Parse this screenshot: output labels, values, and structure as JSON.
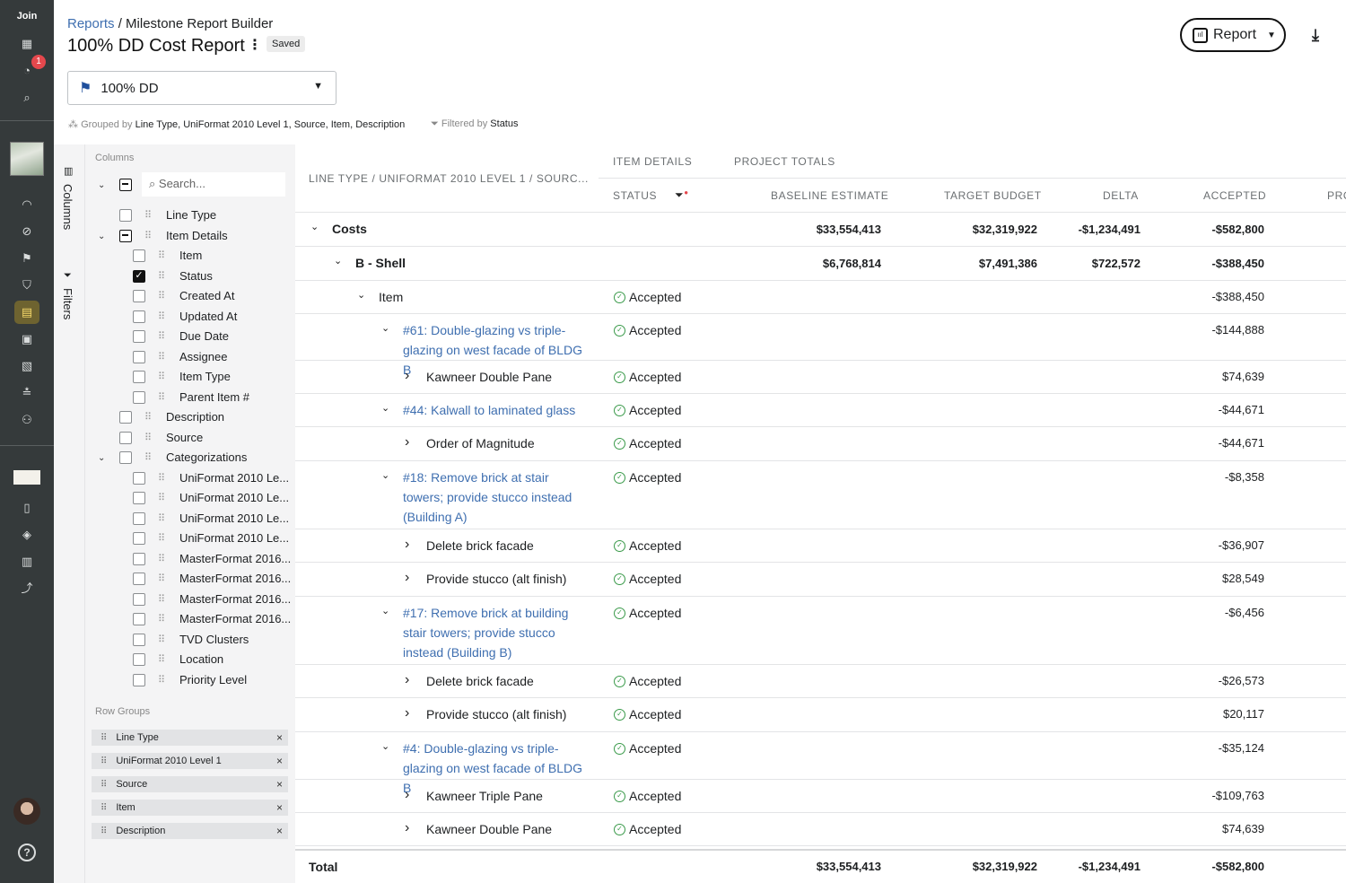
{
  "nav": {
    "brand": "Join",
    "notification_count": "1",
    "help_label": "?"
  },
  "header": {
    "breadcrumb_link": "Reports",
    "breadcrumb_sep": " / ",
    "breadcrumb_current": "Milestone Report Builder",
    "title": "100% DD Cost Report",
    "saved_badge": "Saved",
    "report_button": "Report"
  },
  "milestone_select": {
    "value": "100% DD"
  },
  "grouping": {
    "grouped_prefix": "Grouped by",
    "grouped_value": "Line Type, UniFormat 2010 Level 1, Source, Item, Description",
    "filtered_prefix": "Filtered by",
    "filtered_value": "Status"
  },
  "side_tabs": {
    "columns": "Columns",
    "filters": "Filters"
  },
  "columns_panel": {
    "header": "Columns",
    "search_placeholder": "Search...",
    "items": [
      {
        "label": "Line Type",
        "checked": false
      },
      {
        "label": "Item Details",
        "checked": "mixed"
      },
      {
        "label": "Item",
        "checked": false
      },
      {
        "label": "Status",
        "checked": true
      },
      {
        "label": "Created At",
        "checked": false
      },
      {
        "label": "Updated At",
        "checked": false
      },
      {
        "label": "Due Date",
        "checked": false
      },
      {
        "label": "Assignee",
        "checked": false
      },
      {
        "label": "Item Type",
        "checked": false
      },
      {
        "label": "Parent Item #",
        "checked": false
      },
      {
        "label": "Description",
        "checked": false
      },
      {
        "label": "Source",
        "checked": false
      },
      {
        "label": "Categorizations",
        "checked": false
      },
      {
        "label": "UniFormat 2010 Le...",
        "checked": false
      },
      {
        "label": "UniFormat 2010 Le...",
        "checked": false
      },
      {
        "label": "UniFormat 2010 Le...",
        "checked": false
      },
      {
        "label": "UniFormat 2010 Le...",
        "checked": false
      },
      {
        "label": "MasterFormat 2016...",
        "checked": false
      },
      {
        "label": "MasterFormat 2016...",
        "checked": false
      },
      {
        "label": "MasterFormat 2016...",
        "checked": false
      },
      {
        "label": "MasterFormat 2016...",
        "checked": false
      },
      {
        "label": "TVD Clusters",
        "checked": false
      },
      {
        "label": "Location",
        "checked": false
      },
      {
        "label": "Priority Level",
        "checked": false
      }
    ]
  },
  "row_groups": {
    "header": "Row Groups",
    "items": [
      "Line Type",
      "UniFormat 2010 Level 1",
      "Source",
      "Item",
      "Description"
    ]
  },
  "table": {
    "group_header": "LINE TYPE / UNIFORMAT 2010 LEVEL 1 / SOURC...",
    "band_item_details": "ITEM DETAILS",
    "band_project_totals": "PROJECT TOTALS",
    "col_status": "STATUS",
    "col_baseline": "BASELINE ESTIMATE",
    "col_target": "TARGET BUDGET",
    "col_delta": "DELTA",
    "col_accepted": "ACCEPTED",
    "col_pro": "PRO",
    "rows": [
      {
        "label": "Costs",
        "status": "",
        "baseline": "$33,554,413",
        "target": "$32,319,922",
        "delta": "-$1,234,491",
        "accepted": "-$582,800"
      },
      {
        "label": "B - Shell",
        "status": "",
        "baseline": "$6,768,814",
        "target": "$7,491,386",
        "delta": "$722,572",
        "accepted": "-$388,450"
      },
      {
        "label": "Item",
        "status": "Accepted",
        "accepted": "-$388,450"
      },
      {
        "label": "#61: Double-glazing vs triple-glazing on west facade of BLDG B",
        "status": "Accepted",
        "accepted": "-$144,888"
      },
      {
        "label": "Kawneer Double Pane",
        "status": "Accepted",
        "accepted": "$74,639"
      },
      {
        "label": "#44: Kalwall to laminated glass",
        "status": "Accepted",
        "accepted": "-$44,671"
      },
      {
        "label": "Order of Magnitude",
        "status": "Accepted",
        "accepted": "-$44,671"
      },
      {
        "label": "#18: Remove brick at stair towers; provide stucco instead (Building A)",
        "status": "Accepted",
        "accepted": "-$8,358"
      },
      {
        "label": "Delete brick facade",
        "status": "Accepted",
        "accepted": "-$36,907"
      },
      {
        "label": "Provide stucco (alt finish)",
        "status": "Accepted",
        "accepted": "$28,549"
      },
      {
        "label": "#17: Remove brick at building stair towers; provide stucco instead (Building B)",
        "status": "Accepted",
        "accepted": "-$6,456"
      },
      {
        "label": "Delete brick facade",
        "status": "Accepted",
        "accepted": "-$26,573"
      },
      {
        "label": "Provide stucco (alt finish)",
        "status": "Accepted",
        "accepted": "$20,117"
      },
      {
        "label": "#4: Double-glazing vs triple-glazing on west facade of BLDG B",
        "status": "Accepted",
        "accepted": "-$35,124"
      },
      {
        "label": "Kawneer Triple Pane",
        "status": "Accepted",
        "accepted": "-$109,763"
      },
      {
        "label": "Kawneer Double Pane",
        "status": "Accepted",
        "accepted": "$74,639"
      }
    ],
    "total": {
      "label": "Total",
      "baseline": "$33,554,413",
      "target": "$32,319,922",
      "delta": "-$1,234,491",
      "accepted": "-$582,800"
    }
  }
}
